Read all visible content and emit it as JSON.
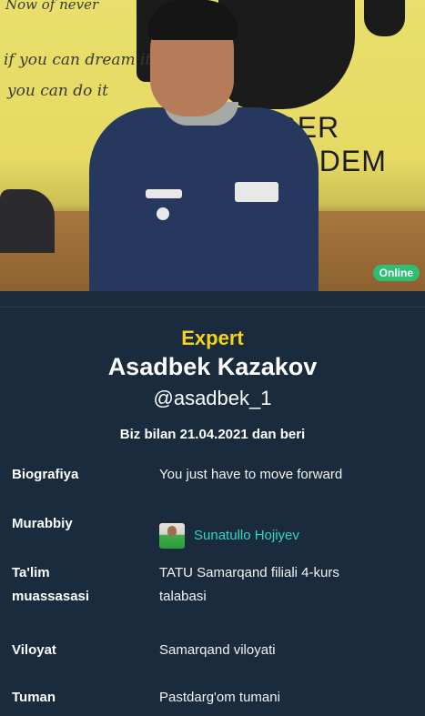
{
  "photo": {
    "wall_text_1": "Now of never",
    "wall_text_2": "if you can dream it",
    "wall_text_3": "you can do it",
    "wall_text_4": "YBER ACADEM",
    "status_badge": "Online"
  },
  "profile": {
    "rank": "Expert",
    "name": "Asadbek Kazakov",
    "username": "@asadbek_1",
    "since": "Biz bilan 21.04.2021 dan beri"
  },
  "details": [
    {
      "label": "Biografiya",
      "value": "You just have to move forward"
    },
    {
      "label": "Murabbiy",
      "value": "Sunatullo Hojiyev"
    },
    {
      "label": "Ta'lim muassasasi",
      "value": "TATU Samarqand filiali 4-kurs talabasi"
    },
    {
      "label": "Viloyat",
      "value": "Samarqand viloyati"
    },
    {
      "label": "Tuman",
      "value": "Pastdarg'om tumani"
    }
  ],
  "colors": {
    "background": "#1a2b3e",
    "rank": "#f4d31a",
    "link": "#2fd6c8",
    "online": "#2ebf74"
  }
}
